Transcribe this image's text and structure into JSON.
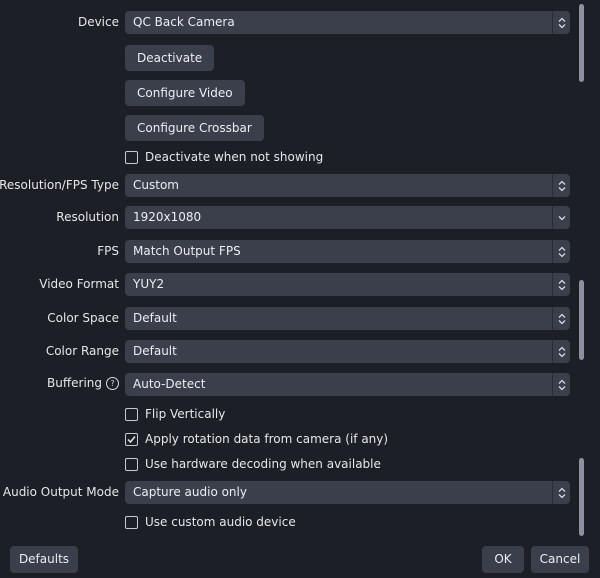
{
  "form": {
    "device": {
      "label": "Device",
      "value": "QC Back Camera"
    },
    "deactivate_button": "Deactivate",
    "configure_video_button": "Configure Video",
    "configure_crossbar_button": "Configure Crossbar",
    "deactivate_when_not_showing": {
      "label": "Deactivate when not showing",
      "checked": false
    },
    "resolution_fps_type": {
      "label": "Resolution/FPS Type",
      "value": "Custom"
    },
    "resolution": {
      "label": "Resolution",
      "value": "1920x1080"
    },
    "fps": {
      "label": "FPS",
      "value": "Match Output FPS"
    },
    "video_format": {
      "label": "Video Format",
      "value": "YUY2"
    },
    "color_space": {
      "label": "Color Space",
      "value": "Default"
    },
    "color_range": {
      "label": "Color Range",
      "value": "Default"
    },
    "buffering": {
      "label": "Buffering",
      "value": "Auto-Detect",
      "help_icon": "?"
    },
    "flip_vertically": {
      "label": "Flip Vertically",
      "checked": false
    },
    "apply_rotation": {
      "label": "Apply rotation data from camera (if any)",
      "checked": true
    },
    "hardware_decoding": {
      "label": "Use hardware decoding when available",
      "checked": false
    },
    "audio_output_mode": {
      "label": "Audio Output Mode",
      "value": "Capture audio only"
    },
    "custom_audio_device": {
      "label": "Use custom audio device",
      "checked": false
    }
  },
  "footer": {
    "defaults_button": "Defaults",
    "ok_button": "OK",
    "cancel_button": "Cancel"
  },
  "colors": {
    "background": "#1d1f26",
    "control": "#3b3e4b",
    "text": "#e4e5e9"
  }
}
